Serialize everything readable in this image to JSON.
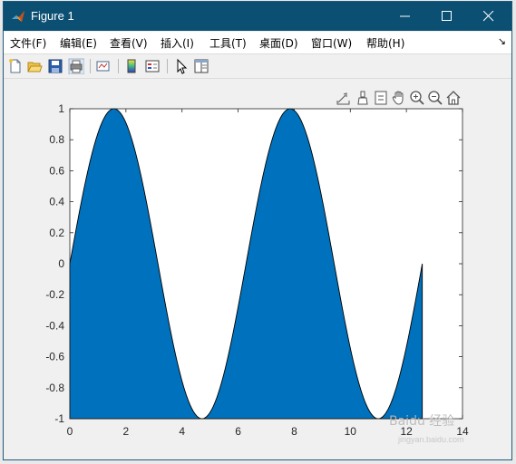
{
  "window": {
    "title": "Figure 1"
  },
  "menu": {
    "items": [
      "文件(F)",
      "编辑(E)",
      "查看(V)",
      "插入(I)",
      "工具(T)",
      "桌面(D)",
      "窗口(W)",
      "帮助(H)"
    ],
    "overflow_icon": "chevron-right-icon"
  },
  "toolbar": {
    "icons": [
      "new-figure-icon",
      "open-file-icon",
      "save-icon",
      "print-icon",
      "link-plot-icon",
      "colorbar-icon",
      "legend-icon",
      "edit-plot-icon",
      "property-inspector-icon"
    ]
  },
  "axes_toolbar": {
    "icons": [
      "export-icon",
      "brush-icon",
      "data-tips-icon",
      "pan-icon",
      "zoom-in-icon",
      "zoom-out-icon",
      "home-icon"
    ]
  },
  "colors": {
    "titlebar": "#0b4f73",
    "fill": "#0072bd",
    "axes_bg": "#ffffff",
    "figure_bg": "#f0f0f0"
  },
  "chart_data": {
    "type": "area",
    "function": "sin(x)",
    "x_range": [
      0,
      12.566
    ],
    "xlim": [
      0,
      14
    ],
    "ylim": [
      -1,
      1
    ],
    "xticks": [
      "0",
      "2",
      "4",
      "6",
      "8",
      "10",
      "12",
      "14"
    ],
    "yticks": [
      "1",
      "0.8",
      "0.6",
      "0.4",
      "0.2",
      "0",
      "-0.2",
      "-0.4",
      "-0.6",
      "-0.8",
      "-1"
    ],
    "baseline": -1,
    "grid": false,
    "title": "",
    "xlabel": "",
    "ylabel": ""
  },
  "watermark": {
    "text": "Baidu 经验",
    "sub": "jingyan.baidu.com"
  }
}
